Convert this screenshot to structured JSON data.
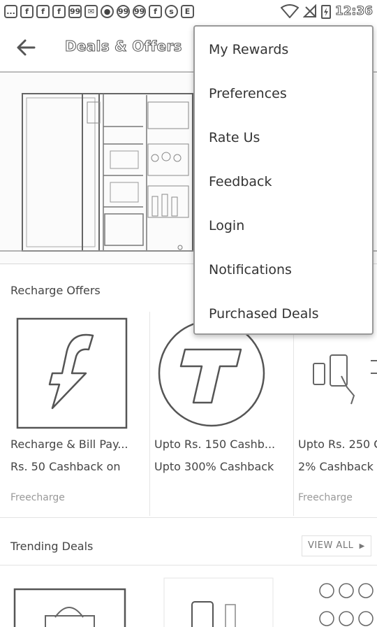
{
  "status_bar": {
    "notification_icons": [
      "...",
      "f",
      "f",
      "f",
      "99",
      "mail",
      "drop",
      "99",
      "99",
      "f",
      "s",
      "E"
    ],
    "time": "12:36"
  },
  "toolbar": {
    "title": "Deals & Offers"
  },
  "menu": {
    "items": [
      {
        "label": "My Rewards"
      },
      {
        "label": "Preferences"
      },
      {
        "label": "Rate Us"
      },
      {
        "label": "Feedback"
      },
      {
        "label": "Login"
      },
      {
        "label": "Notifications"
      },
      {
        "label": "Purchased Deals"
      }
    ]
  },
  "recharge": {
    "title": "Recharge Offers",
    "cards": [
      {
        "line1": "Recharge & Bill Pay...",
        "line2": "Rs. 50 Cashback on",
        "merchant": "Freecharge",
        "icon": "freecharge-logo-icon"
      },
      {
        "line1": "Upto Rs. 150 Cashb...",
        "line2": "Upto 300% Cashback",
        "merchant": "",
        "icon": "t-logo-icon"
      },
      {
        "line1": "Upto Rs. 250 C",
        "line2": "2% Cashback",
        "merchant": "Freecharge",
        "icon": "phone-payment-icon"
      }
    ]
  },
  "trending": {
    "title": "Trending Deals",
    "view_all": "VIEW ALL"
  }
}
